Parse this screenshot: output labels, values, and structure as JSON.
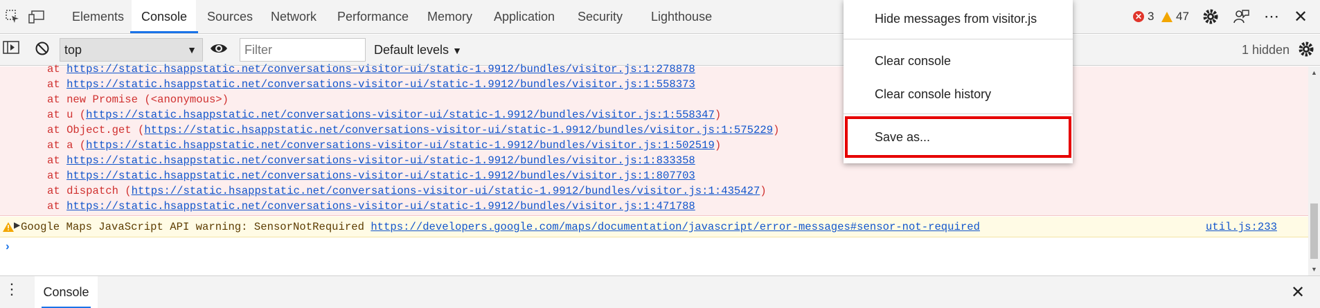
{
  "toolbar": {
    "tabs": [
      "Elements",
      "Console",
      "Sources",
      "Network",
      "Performance",
      "Memory",
      "Application",
      "Security",
      "Lighthouse"
    ],
    "errors_count": "3",
    "warnings_count": "47"
  },
  "console_toolbar": {
    "context": "top",
    "filter_placeholder": "Filter",
    "levels": "Default levels",
    "hidden": "1 hidden"
  },
  "output": {
    "stack": [
      {
        "prefix": "at ",
        "url": "https://static.hsappstatic.net/conversations-visitor-ui/static-1.9912/bundles/visitor.js:1:278878",
        "suffix": ""
      },
      {
        "prefix": "at ",
        "url": "https://static.hsappstatic.net/conversations-visitor-ui/static-1.9912/bundles/visitor.js:1:558373",
        "suffix": ""
      },
      {
        "prefix": "at new Promise (<anonymous>)",
        "url": "",
        "suffix": ""
      },
      {
        "prefix": "at u (",
        "url": "https://static.hsappstatic.net/conversations-visitor-ui/static-1.9912/bundles/visitor.js:1:558347",
        "suffix": ")"
      },
      {
        "prefix": "at Object.get (",
        "url": "https://static.hsappstatic.net/conversations-visitor-ui/static-1.9912/bundles/visitor.js:1:575229",
        "suffix": ")"
      },
      {
        "prefix": "at a (",
        "url": "https://static.hsappstatic.net/conversations-visitor-ui/static-1.9912/bundles/visitor.js:1:502519",
        "suffix": ")"
      },
      {
        "prefix": "at ",
        "url": "https://static.hsappstatic.net/conversations-visitor-ui/static-1.9912/bundles/visitor.js:1:833358",
        "suffix": ""
      },
      {
        "prefix": "at ",
        "url": "https://static.hsappstatic.net/conversations-visitor-ui/static-1.9912/bundles/visitor.js:1:807703",
        "suffix": ""
      },
      {
        "prefix": "at dispatch (",
        "url": "https://static.hsappstatic.net/conversations-visitor-ui/static-1.9912/bundles/visitor.js:1:435427",
        "suffix": ")"
      },
      {
        "prefix": "at ",
        "url": "https://static.hsappstatic.net/conversations-visitor-ui/static-1.9912/bundles/visitor.js:1:471788",
        "suffix": ""
      }
    ],
    "warning": {
      "text": "Google Maps JavaScript API warning: SensorNotRequired ",
      "url": "https://developers.google.com/maps/documentation/javascript/error-messages#sensor-not-required",
      "source": "util.js:233"
    }
  },
  "drawer": {
    "tab": "Console"
  },
  "context_menu": {
    "hide": "Hide messages from visitor.js",
    "clear": "Clear console",
    "clear_history": "Clear console history",
    "save": "Save as..."
  },
  "colors": {
    "accent": "#1a73e8",
    "error_bg": "#fdeeee",
    "error_text": "#d0302f",
    "warning_bg": "#fffbe5",
    "highlight": "#e60000"
  }
}
